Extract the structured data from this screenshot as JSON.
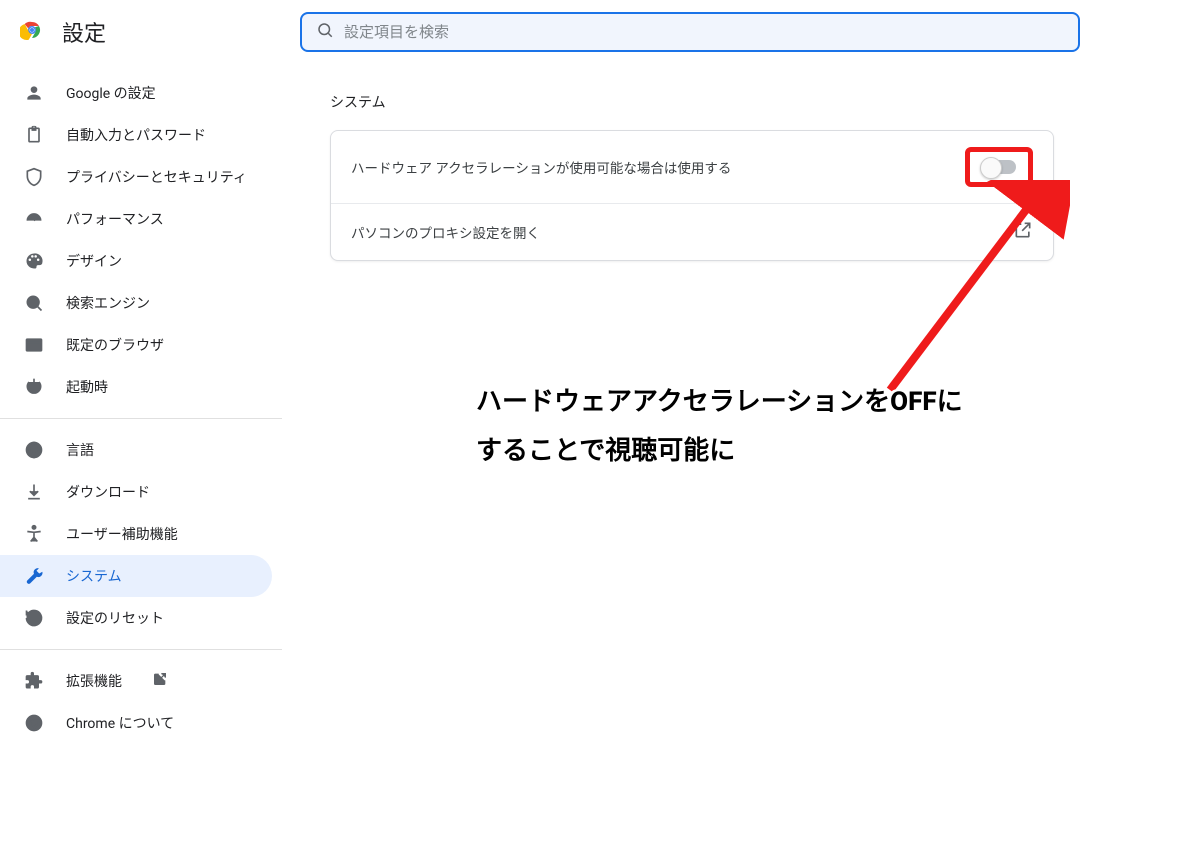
{
  "header": {
    "title": "設定",
    "search_placeholder": "設定項目を検索"
  },
  "sidebar": {
    "items": [
      {
        "label": "Google の設定"
      },
      {
        "label": "自動入力とパスワード"
      },
      {
        "label": "プライバシーとセキュリティ"
      },
      {
        "label": "パフォーマンス"
      },
      {
        "label": "デザイン"
      },
      {
        "label": "検索エンジン"
      },
      {
        "label": "既定のブラウザ"
      },
      {
        "label": "起動時"
      },
      {
        "label": "言語"
      },
      {
        "label": "ダウンロード"
      },
      {
        "label": "ユーザー補助機能"
      },
      {
        "label": "システム"
      },
      {
        "label": "設定のリセット"
      },
      {
        "label": "拡張機能"
      },
      {
        "label": "Chrome について"
      }
    ]
  },
  "main": {
    "section_title": "システム",
    "rows": [
      {
        "label": "ハードウェア アクセラレーションが使用可能な場合は使用する"
      },
      {
        "label": "パソコンのプロキシ設定を開く"
      }
    ]
  },
  "annotation": {
    "line1": "ハードウェアアクセラレーションをOFFに",
    "line2": "することで視聴可能に"
  }
}
